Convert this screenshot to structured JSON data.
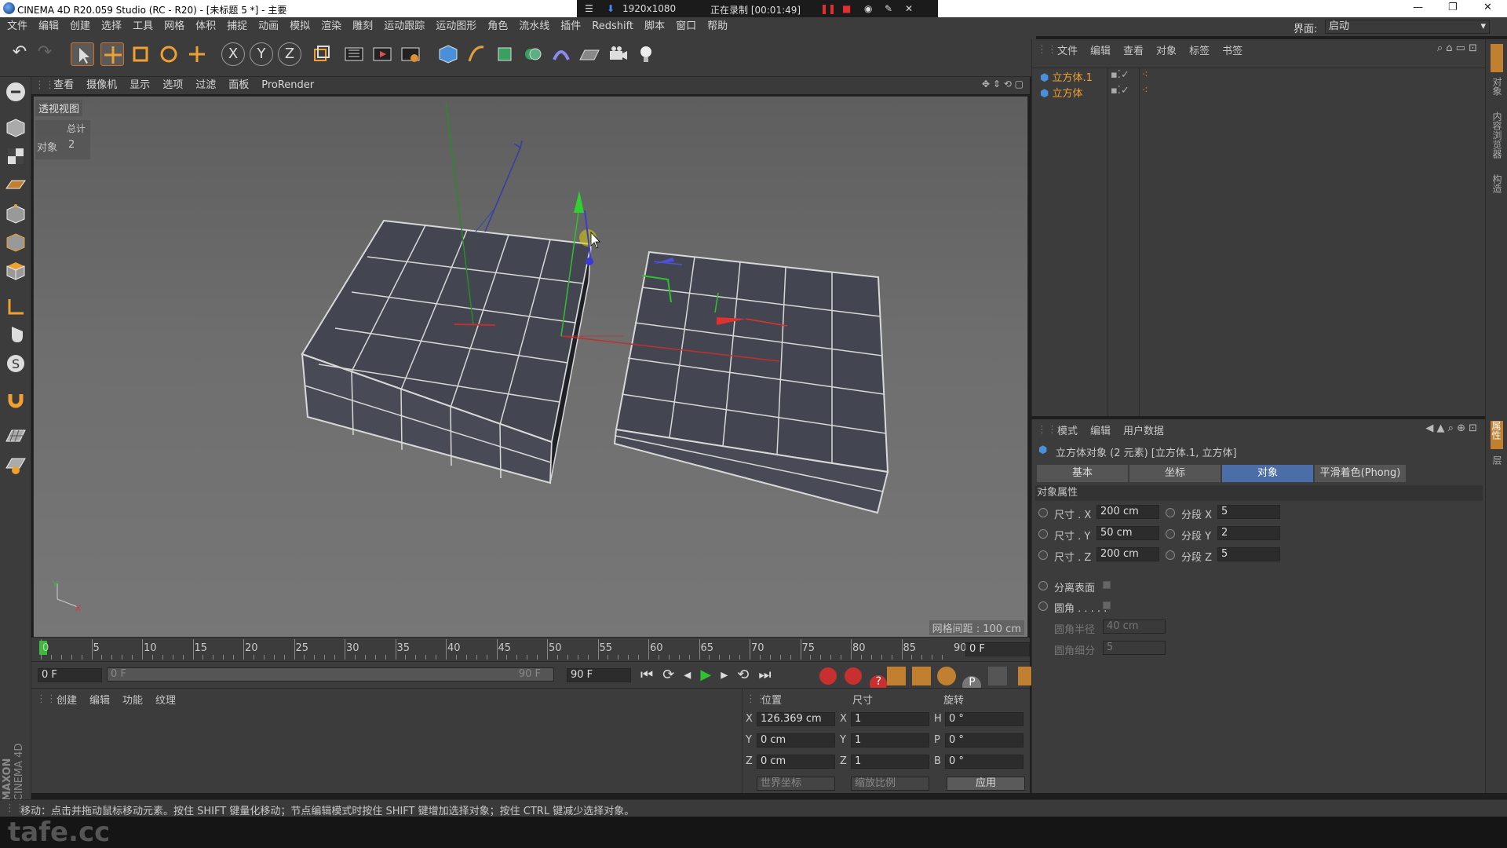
{
  "window": {
    "title": "CINEMA 4D R20.059 Studio (RC - R20) - [未标题 5 *] - 主要"
  },
  "recorder": {
    "resolution": "1920x1080",
    "status": "正在录制 [00:01:49]"
  },
  "menu": [
    "文件",
    "编辑",
    "创建",
    "选择",
    "工具",
    "网格",
    "体积",
    "捕捉",
    "动画",
    "模拟",
    "渲染",
    "雕刻",
    "运动跟踪",
    "运动图形",
    "角色",
    "流水线",
    "插件",
    "Redshift",
    "脚本",
    "窗口",
    "帮助"
  ],
  "layout": {
    "label": "界面:",
    "value": "启动"
  },
  "viewport": {
    "menu": [
      "查看",
      "摄像机",
      "显示",
      "选项",
      "过滤",
      "面板",
      "ProRender"
    ],
    "name": "透视视图",
    "stats_header": "总计",
    "stats_label": "对象",
    "stats_value": "2",
    "grid_spacing": "网格间距 : 100 cm"
  },
  "timeline": {
    "ticks": [
      "0",
      "5",
      "10",
      "15",
      "20",
      "25",
      "30",
      "35",
      "40",
      "45",
      "50",
      "55",
      "60",
      "65",
      "70",
      "75",
      "80",
      "85",
      "90"
    ],
    "current": "0 F",
    "start": "0 F",
    "range_start": "0 F",
    "range_end": "90 F",
    "end": "90 F"
  },
  "material": {
    "menu": [
      "创建",
      "编辑",
      "功能",
      "纹理"
    ]
  },
  "coords": {
    "headers": [
      "位置",
      "尺寸",
      "旋转"
    ],
    "rows": [
      {
        "axis": "X",
        "pos": "126.369 cm",
        "saxis": "X",
        "size": "1",
        "raxis": "H",
        "rot": "0 °"
      },
      {
        "axis": "Y",
        "pos": "0 cm",
        "saxis": "Y",
        "size": "1",
        "raxis": "P",
        "rot": "0 °"
      },
      {
        "axis": "Z",
        "pos": "0 cm",
        "saxis": "Z",
        "size": "1",
        "raxis": "B",
        "rot": "0 °"
      }
    ],
    "mode1": "世界坐标",
    "mode2": "缩放比例",
    "apply": "应用"
  },
  "objects": {
    "menu": [
      "文件",
      "编辑",
      "查看",
      "对象",
      "标签",
      "书签"
    ],
    "items": [
      "立方体.1",
      "立方体"
    ]
  },
  "attributes": {
    "menu": [
      "模式",
      "编辑",
      "用户数据"
    ],
    "title": "立方体对象 (2 元素) [立方体.1, 立方体]",
    "tabs": [
      "基本",
      "坐标",
      "对象",
      "平滑着色(Phong)"
    ],
    "section": "对象属性",
    "size_x_label": "尺寸 . X",
    "size_x": "200 cm",
    "size_y_label": "尺寸 . Y",
    "size_y": "50 cm",
    "size_z_label": "尺寸 . Z",
    "size_z": "200 cm",
    "seg_x_label": "分段 X",
    "seg_x": "5",
    "seg_y_label": "分段 Y",
    "seg_y": "2",
    "seg_z_label": "分段 Z",
    "seg_z": "5",
    "separate_label": "分离表面",
    "fillet_label": "圆角 . . . . .",
    "fillet_radius_label": "圆角半径",
    "fillet_radius": "40 cm",
    "fillet_sub_label": "圆角细分",
    "fillet_sub": "5"
  },
  "right_strip": [
    "对象",
    "内容浏览器",
    "构造",
    "属性",
    "层"
  ],
  "status": "移动：点击并拖动鼠标移动元素。按住 SHIFT 键量化移动；节点编辑模式时按住 SHIFT 键增加选择对象；按住 CTRL 键减少选择对象。",
  "brand": {
    "maxon": "MAXON",
    "c4d": "CINEMA 4D",
    "watermark": "tafe.cc"
  }
}
